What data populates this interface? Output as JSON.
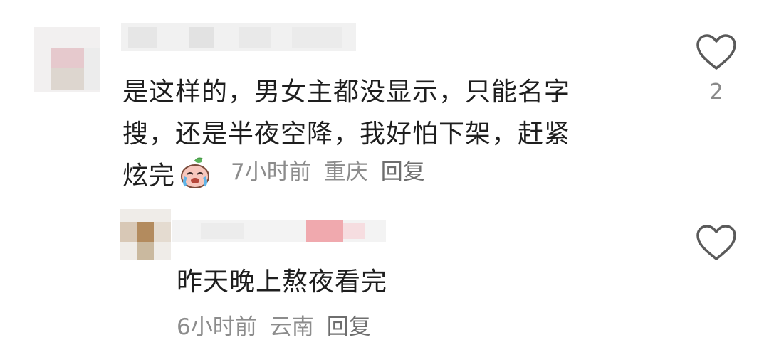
{
  "comments": [
    {
      "text_lines": [
        "是这样的，男女主都没显示，只能名字",
        "搜，还是半夜空降，我好怕下架，赶紧",
        "炫完"
      ],
      "emoji": "crying-face-emoji",
      "time": "7小时前",
      "location": "重庆",
      "reply_label": "回复",
      "like_count": "2",
      "like_icon": "heart-outline-icon"
    },
    {
      "text": "昨天晚上熬夜看完",
      "time": "6小时前",
      "location": "云南",
      "reply_label": "回复",
      "like_icon": "heart-outline-icon"
    }
  ],
  "colors": {
    "text": "#1e1e1e",
    "meta": "#8c8c8c",
    "icon": "#5a5a5a",
    "background": "#ffffff"
  }
}
